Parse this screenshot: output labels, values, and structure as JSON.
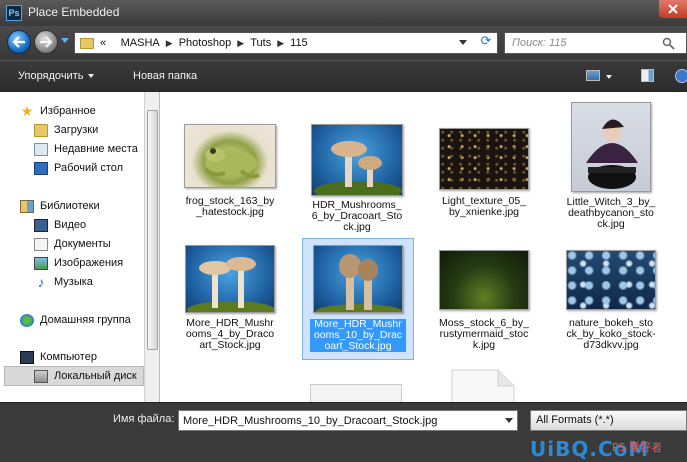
{
  "window": {
    "title": "Place Embedded",
    "app_icon": "Ps"
  },
  "address": {
    "prefix": "«",
    "crumbs": [
      "MASHA",
      "Photoshop",
      "Tuts",
      "115"
    ],
    "search_placeholder": "Поиск: 115"
  },
  "toolbar": {
    "organize_label": "Упорядочить",
    "new_folder_label": "Новая папка"
  },
  "nav": {
    "items": [
      {
        "label": "Избранное",
        "icon": "star-icon"
      },
      {
        "label": "Загрузки",
        "icon": "downloads-folder-icon"
      },
      {
        "label": "Недавние места",
        "icon": "recent-places-icon"
      },
      {
        "label": "Рабочий стол",
        "icon": "desktop-icon"
      },
      {
        "label": "Библиотеки",
        "icon": "libraries-icon"
      },
      {
        "label": "Видео",
        "icon": "video-icon"
      },
      {
        "label": "Документы",
        "icon": "documents-icon"
      },
      {
        "label": "Изображения",
        "icon": "images-icon"
      },
      {
        "label": "Музыка",
        "icon": "music-icon"
      },
      {
        "label": "Домашняя группа",
        "icon": "homegroup-icon"
      },
      {
        "label": "Компьютер",
        "icon": "computer-icon"
      },
      {
        "label": "Локальный диск",
        "icon": "local-disk-icon"
      }
    ],
    "selected_index": 11
  },
  "files": [
    {
      "lines": [
        "frog_stock_163_by",
        "_hatestock.jpg"
      ],
      "thumb": "frog"
    },
    {
      "lines": [
        "HDR_Mushrooms_",
        "6_by_Dracoart_Sto",
        "ck.jpg"
      ],
      "thumb": "mushrooms-a"
    },
    {
      "lines": [
        "Light_texture_05_",
        "by_xnienke.jpg"
      ],
      "thumb": "light-texture"
    },
    {
      "lines": [
        "Little_Witch_3_by_",
        "deathbycanon_sto",
        "ck.jpg"
      ],
      "thumb": "witch"
    },
    {
      "lines": [
        "More_HDR_Mushr",
        "ooms_4_by_Draco",
        "art_Stock.jpg"
      ],
      "thumb": "mushrooms-b"
    },
    {
      "lines": [
        "More_HDR_Mushr",
        "ooms_10_by_Drac",
        "oart_Stock.jpg"
      ],
      "thumb": "mushrooms-c",
      "selected": true
    },
    {
      "lines": [
        "Moss_stock_6_by_",
        "rustymermaid_stoc",
        "k.jpg"
      ],
      "thumb": "moss"
    },
    {
      "lines": [
        "nature_bokeh_sto",
        "ck_by_koko_stock-",
        "d73dkvv.jpg"
      ],
      "thumb": "bokeh"
    }
  ],
  "bottom": {
    "filename_label": "Имя файла:",
    "filename_value": "More_HDR_Mushrooms_10_by_Dracoart_Stock.jpg",
    "format_value": "All Formats (*.*)"
  },
  "watermark": {
    "text": "UiBQ.CoM",
    "sub": "PS 爱好者"
  },
  "colors": {
    "selection_fill": "#cfe4fa",
    "selection_caption": "#3399ff",
    "toolbar_bg": "#2c2c2c"
  }
}
